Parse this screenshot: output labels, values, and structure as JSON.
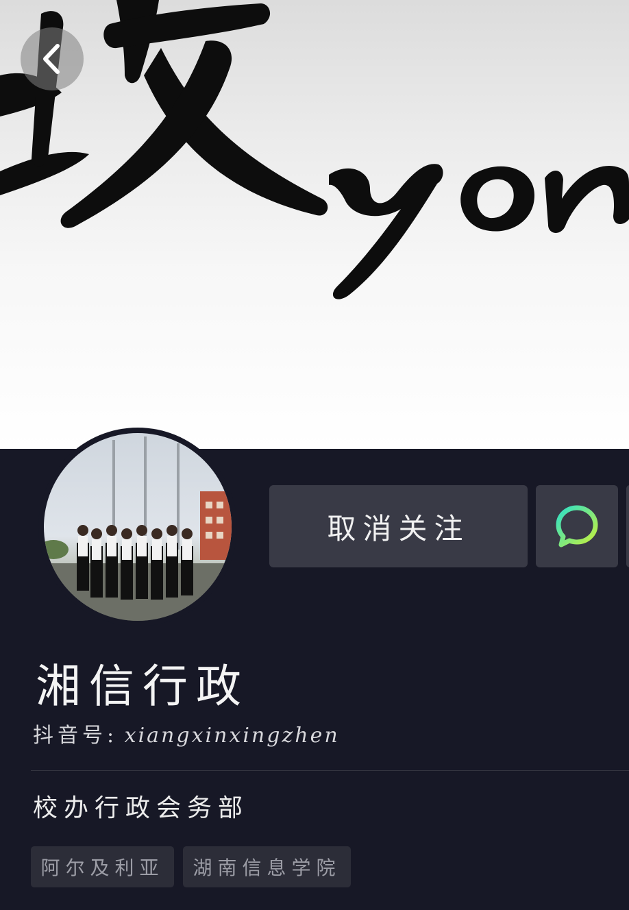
{
  "cover": {
    "image_description_icon": "calligraphy-banner-image"
  },
  "header": {
    "back_icon": "chevron-left-icon"
  },
  "profile": {
    "avatar_icon": "group-photo-avatar",
    "display_name": "湘信行政",
    "account_id_label": "抖音号:",
    "account_id_value": "xiangxinxingzhen",
    "bio": "校办行政会务部",
    "tags": [
      "阿尔及利亚",
      "湖南信息学院"
    ]
  },
  "actions": {
    "unfollow_label": "取消关注",
    "message_icon": "chat-bubble-icon"
  },
  "colors": {
    "panel_bg": "#171826",
    "button_bg": "#393a46",
    "tag_bg": "#2c2d38",
    "message_icon_gradient_start": "#2fe0c8",
    "message_icon_gradient_end": "#c8f03a"
  }
}
